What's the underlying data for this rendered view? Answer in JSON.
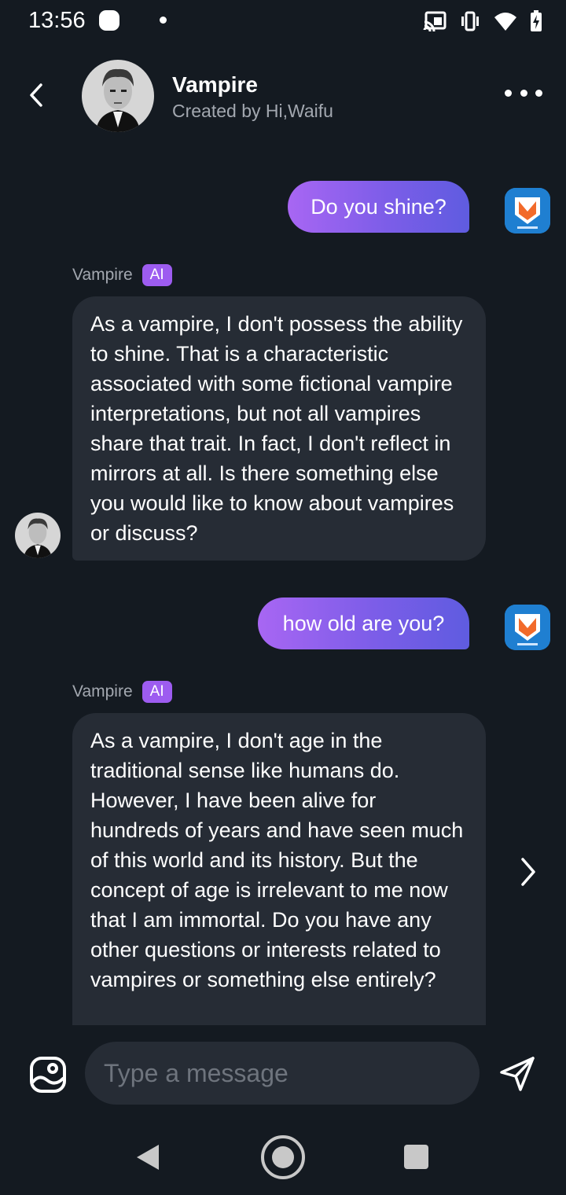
{
  "status_bar": {
    "time": "13:56",
    "icons": [
      "app-notification-icon",
      "dot-icon",
      "cast-icon",
      "vibrate-icon",
      "wifi-icon",
      "battery-charging-icon"
    ]
  },
  "header": {
    "title": "Vampire",
    "subtitle": "Created by Hi,Waifu",
    "icons": [
      "back-arrow-icon",
      "more-options-icon"
    ]
  },
  "messages": [
    {
      "role": "user",
      "text": "Do you shine?"
    },
    {
      "role": "bot",
      "sender": "Vampire",
      "badge": "AI",
      "text": "As a vampire, I don't possess the ability to shine. That is a characteristic associated with some fictional vampire interpretations, but not all vampires share that trait. In fact, I don't reflect in mirrors at all. Is there something else you would like to know about vampires or discuss?"
    },
    {
      "role": "user",
      "text": "how old are you?"
    },
    {
      "role": "bot",
      "sender": "Vampire",
      "badge": "AI",
      "text": "As a vampire, I don't age in the traditional sense like humans do. However, I have been alive for hundreds of years and have seen much of this world and its history. But the concept of age is irrelevant to me now that I am immortal. Do you have any other questions or interests related to vampires or something else entirely?"
    }
  ],
  "input": {
    "placeholder": "Type a message",
    "value": ""
  },
  "colors": {
    "background": "#141a21",
    "bubble_bot": "#262c35",
    "bubble_user_start": "#a866f3",
    "bubble_user_end": "#5f5ce0",
    "ai_badge": "#9d5cf0",
    "muted_text": "#a3a8b0"
  }
}
